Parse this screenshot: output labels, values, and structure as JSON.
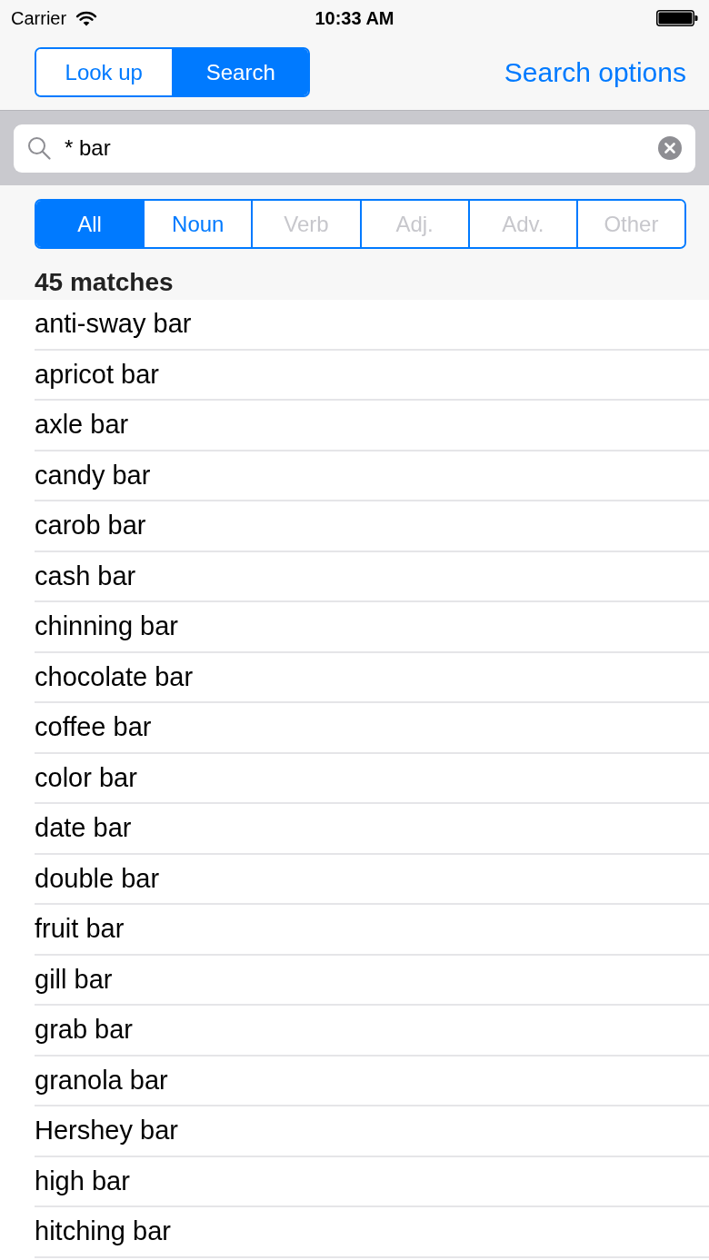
{
  "status_bar": {
    "carrier": "Carrier",
    "time": "10:33 AM"
  },
  "nav_bar": {
    "mode_tabs": [
      {
        "label": "Look up",
        "selected": false
      },
      {
        "label": "Search",
        "selected": true
      }
    ],
    "search_options": "Search options"
  },
  "search": {
    "value": "* bar"
  },
  "filter_tabs": [
    {
      "label": "All",
      "selected": true,
      "disabled": false
    },
    {
      "label": "Noun",
      "selected": false,
      "disabled": false
    },
    {
      "label": "Verb",
      "selected": false,
      "disabled": true
    },
    {
      "label": "Adj.",
      "selected": false,
      "disabled": true
    },
    {
      "label": "Adv.",
      "selected": false,
      "disabled": true
    },
    {
      "label": "Other",
      "selected": false,
      "disabled": true
    }
  ],
  "results": {
    "count": "45 matches",
    "items": [
      "anti-sway bar",
      "apricot bar",
      "axle bar",
      "candy bar",
      "carob bar",
      "cash bar",
      "chinning bar",
      "chocolate bar",
      "coffee bar",
      "color bar",
      "date bar",
      "double bar",
      "fruit bar",
      "gill bar",
      "grab bar",
      "granola bar",
      "Hershey bar",
      "high bar",
      "hitching bar"
    ]
  }
}
